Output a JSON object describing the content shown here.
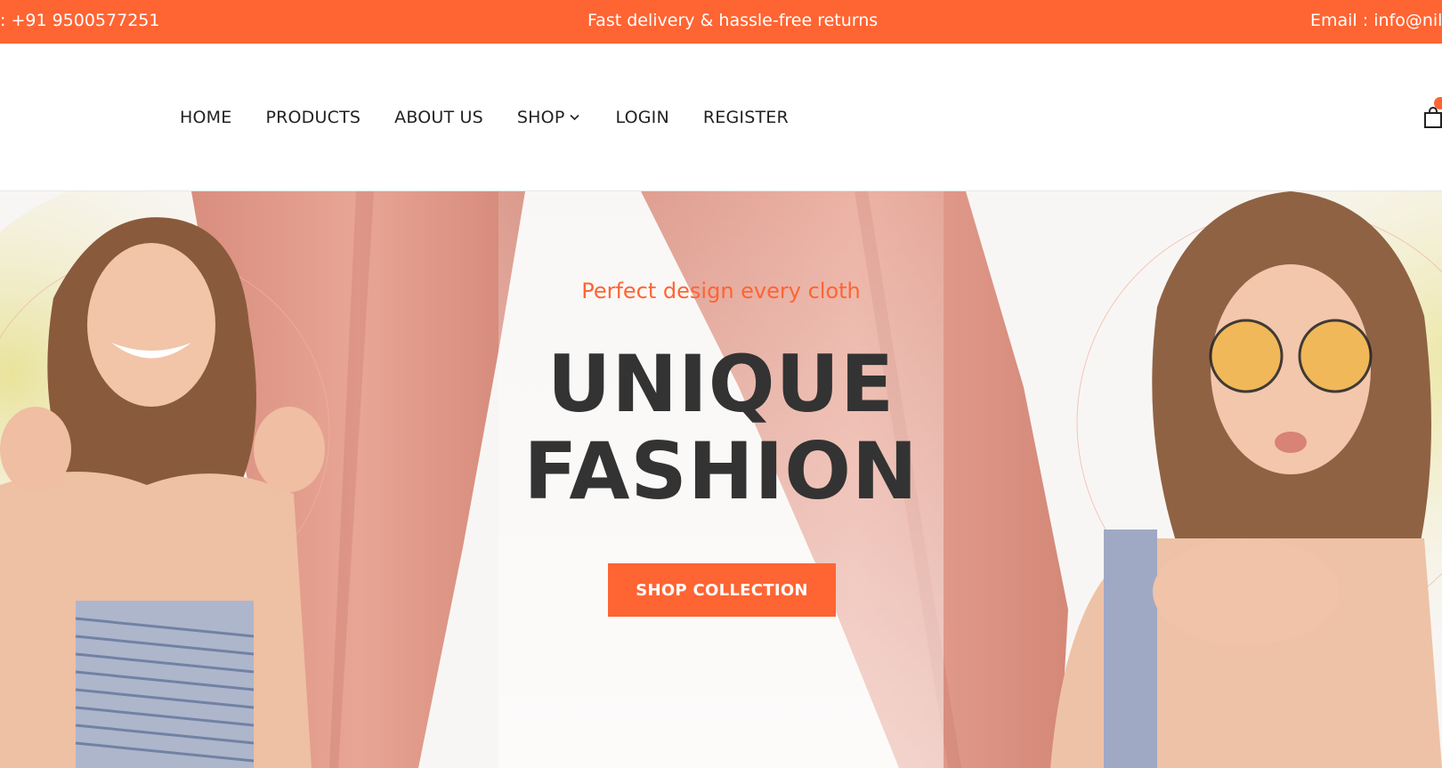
{
  "topbar": {
    "phone": ": +91 9500577251",
    "promo": "Fast delivery & hassle-free returns",
    "email": "Email : info@nila"
  },
  "nav": {
    "items": [
      {
        "label": "HOME"
      },
      {
        "label": "PRODUCTS"
      },
      {
        "label": "ABOUT US"
      },
      {
        "label": "SHOP"
      },
      {
        "label": "LOGIN"
      },
      {
        "label": "REGISTER"
      }
    ]
  },
  "hero": {
    "tagline": "Perfect design every cloth",
    "headline_line1": "UNIQUE",
    "headline_line2": "FASHION",
    "cta_label": "SHOP COLLECTION"
  },
  "colors": {
    "accent": "#ff6433",
    "text_dark": "#333333",
    "nav_text": "#222222"
  },
  "icons": {
    "dropdown": "chevron-down-icon",
    "cart": "shopping-bag-icon"
  }
}
